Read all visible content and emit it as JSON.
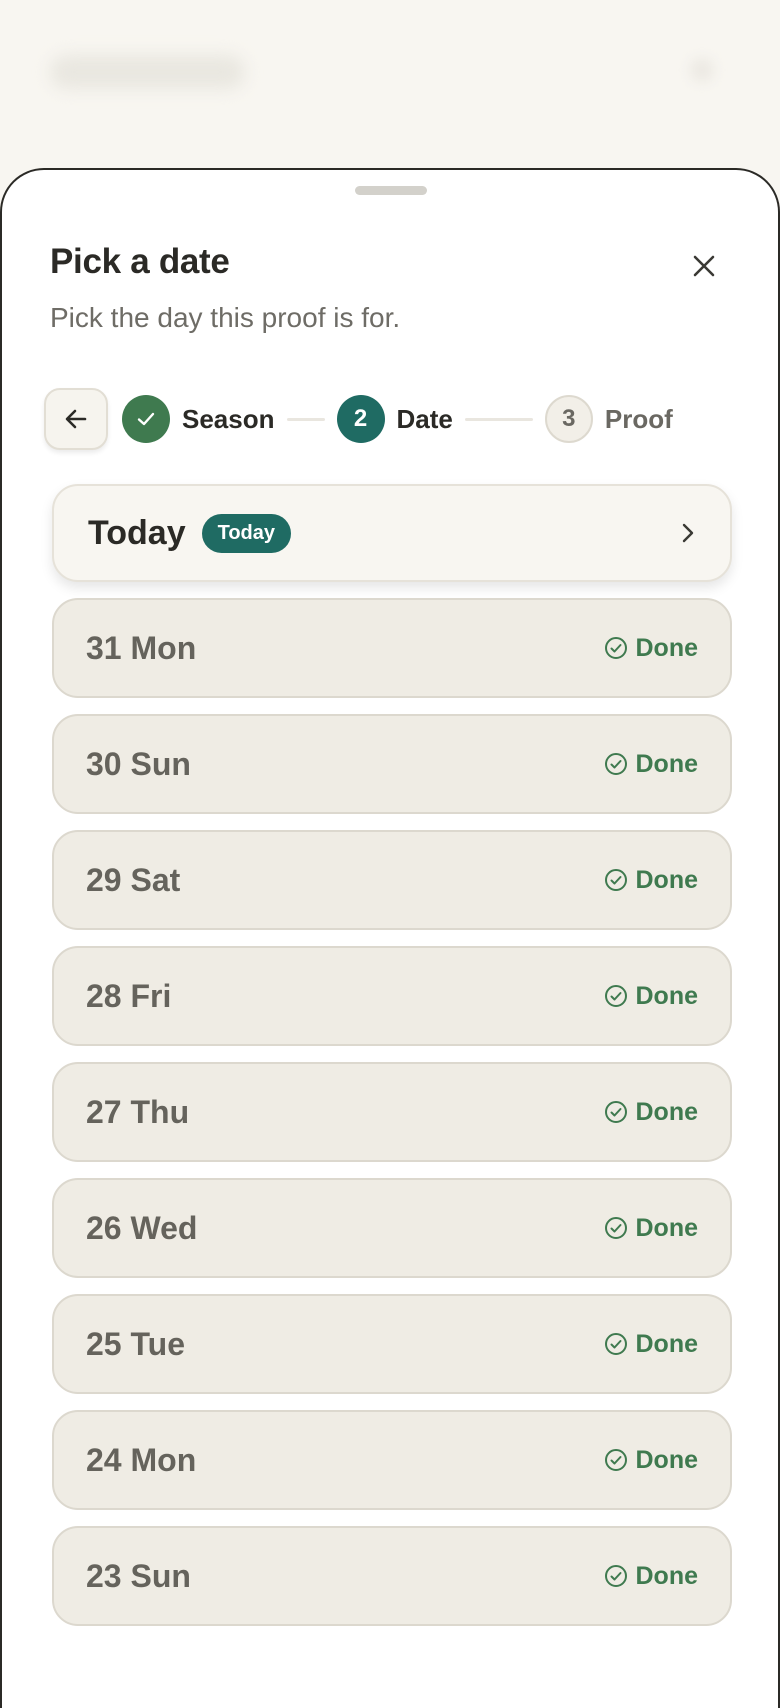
{
  "sheet": {
    "title": "Pick a date",
    "subtitle": "Pick the day this proof is for."
  },
  "stepper": {
    "steps": [
      {
        "number": "",
        "label": "Season",
        "state": "done"
      },
      {
        "number": "2",
        "label": "Date",
        "state": "active"
      },
      {
        "number": "3",
        "label": "Proof",
        "state": "todo"
      }
    ]
  },
  "today": {
    "label": "Today",
    "badge": "Today"
  },
  "days": [
    {
      "label": "31 Mon",
      "status": "Done"
    },
    {
      "label": "30 Sun",
      "status": "Done"
    },
    {
      "label": "29 Sat",
      "status": "Done"
    },
    {
      "label": "28 Fri",
      "status": "Done"
    },
    {
      "label": "27 Thu",
      "status": "Done"
    },
    {
      "label": "26 Wed",
      "status": "Done"
    },
    {
      "label": "25 Tue",
      "status": "Done"
    },
    {
      "label": "24 Mon",
      "status": "Done"
    },
    {
      "label": "23 Sun",
      "status": "Done"
    }
  ],
  "icons": {
    "close": "close-icon",
    "back": "arrow-left-icon",
    "step_done": "check-icon",
    "today_chevron": "chevron-right-icon",
    "day_status": "check-circle-icon"
  },
  "colors": {
    "accent": "#1f6b63",
    "success": "#3f7a4f",
    "card": "#efece4",
    "text": "#2b2a26"
  }
}
